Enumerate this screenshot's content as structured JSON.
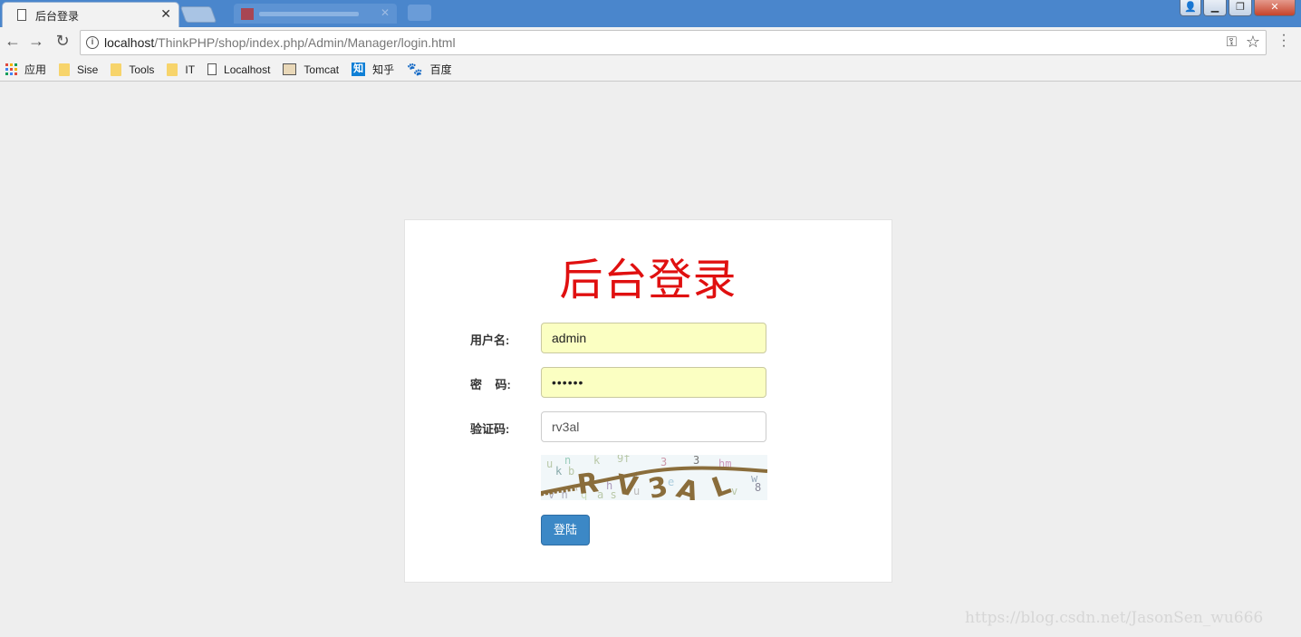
{
  "browser": {
    "active_tab_title": "后台登录",
    "tab_close_glyph": "✕",
    "url_host": "localhost",
    "url_path": "/ThinkPHP/shop/index.php/Admin/Manager/login.html",
    "bookmarks": [
      {
        "label": "应用",
        "icon": "apps-grid-icon"
      },
      {
        "label": "Sise",
        "icon": "folder-icon"
      },
      {
        "label": "Tools",
        "icon": "folder-icon"
      },
      {
        "label": "IT",
        "icon": "folder-icon"
      },
      {
        "label": "Localhost",
        "icon": "page-icon"
      },
      {
        "label": "Tomcat",
        "icon": "tomcat-icon"
      },
      {
        "label": "知乎",
        "icon": "zhihu-icon"
      },
      {
        "label": "百度",
        "icon": "baidu-paw-icon"
      }
    ],
    "zhihu_glyph": "知"
  },
  "login": {
    "title": "后台登录",
    "username_label": "用户名:",
    "username_value": "admin",
    "password_label": "密    码:",
    "password_value": "••••••",
    "captcha_label": "验证码:",
    "captcha_value": "rv3al",
    "captcha_image_text": "RV3AL",
    "submit_label": "登陆"
  },
  "colors": {
    "title_red": "#e01010",
    "button_blue": "#3c88c6",
    "autofill_yellow": "#fbffc2"
  },
  "watermark": "https://blog.csdn.net/JasonSen_wu666"
}
